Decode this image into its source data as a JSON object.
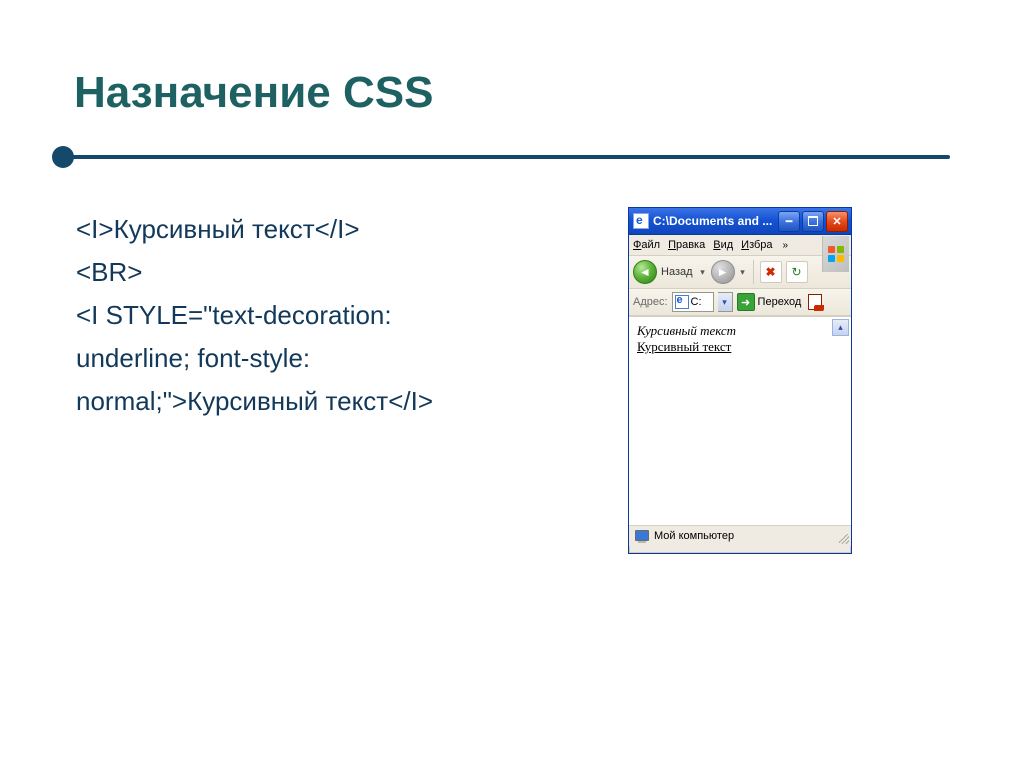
{
  "title": "Назначение CSS",
  "code": {
    "line1": "<I>Курсивный текст</I>",
    "line2": "<BR>",
    "line3a": "<I STYLE=\"text-decoration:",
    "line3b": "underline; font-style:",
    "line3c": "normal;\">Курсивный текст</I>"
  },
  "ie": {
    "title": "C:\\Documents and ...",
    "menu": {
      "file": "Файл",
      "edit": "Правка",
      "view": "Вид",
      "fav": "Избра"
    },
    "back_label": "Назад",
    "addr_label": "Адрес:",
    "addr_value": "C:",
    "go_label": "Переход",
    "content_line1": "Курсивный текст",
    "content_line2": "Курсивный текст",
    "status": "Мой компьютер"
  }
}
